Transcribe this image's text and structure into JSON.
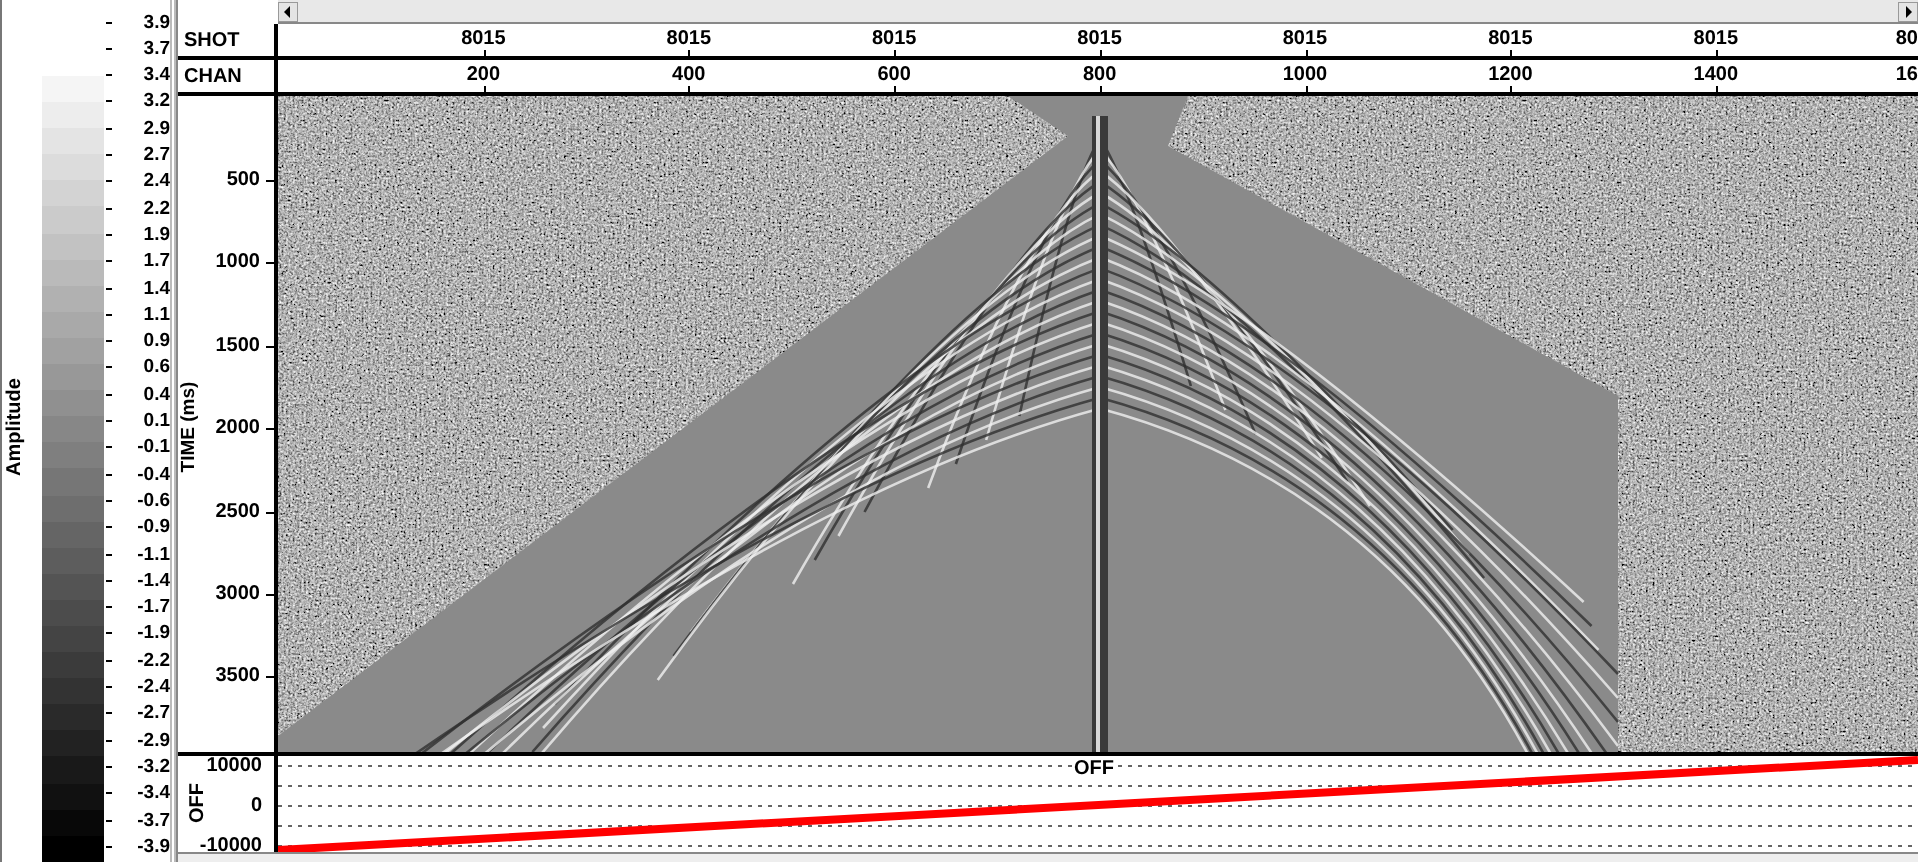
{
  "colorbar": {
    "title": "Amplitude",
    "labels": [
      "3.9",
      "3.7",
      "3.4",
      "3.2",
      "2.9",
      "2.7",
      "2.4",
      "2.2",
      "1.9",
      "1.7",
      "1.4",
      "1.1",
      "0.9",
      "0.6",
      "0.4",
      "0.1",
      "-0.1",
      "-0.4",
      "-0.6",
      "-0.9",
      "-1.1",
      "-1.4",
      "-1.7",
      "-1.9",
      "-2.2",
      "-2.4",
      "-2.7",
      "-2.9",
      "-3.2",
      "-3.4",
      "-3.7",
      "-3.9"
    ]
  },
  "header": {
    "rows": [
      {
        "label": "SHOT",
        "ticks": [
          "8015",
          "8015",
          "8015",
          "8015",
          "8015",
          "8015",
          "8015"
        ],
        "cut_tick": "80"
      },
      {
        "label": "CHAN",
        "ticks": [
          "200",
          "400",
          "600",
          "800",
          "1000",
          "1200",
          "1400"
        ],
        "cut_tick": "16"
      }
    ]
  },
  "time_axis": {
    "label": "TIME (ms)",
    "ticks": [
      "500",
      "1000",
      "1500",
      "2000",
      "2500",
      "3000",
      "3500"
    ]
  },
  "offset_panel": {
    "title": "OFF",
    "axis_label": "OFF",
    "ticks": [
      "10000",
      "0",
      "-10000"
    ]
  }
}
